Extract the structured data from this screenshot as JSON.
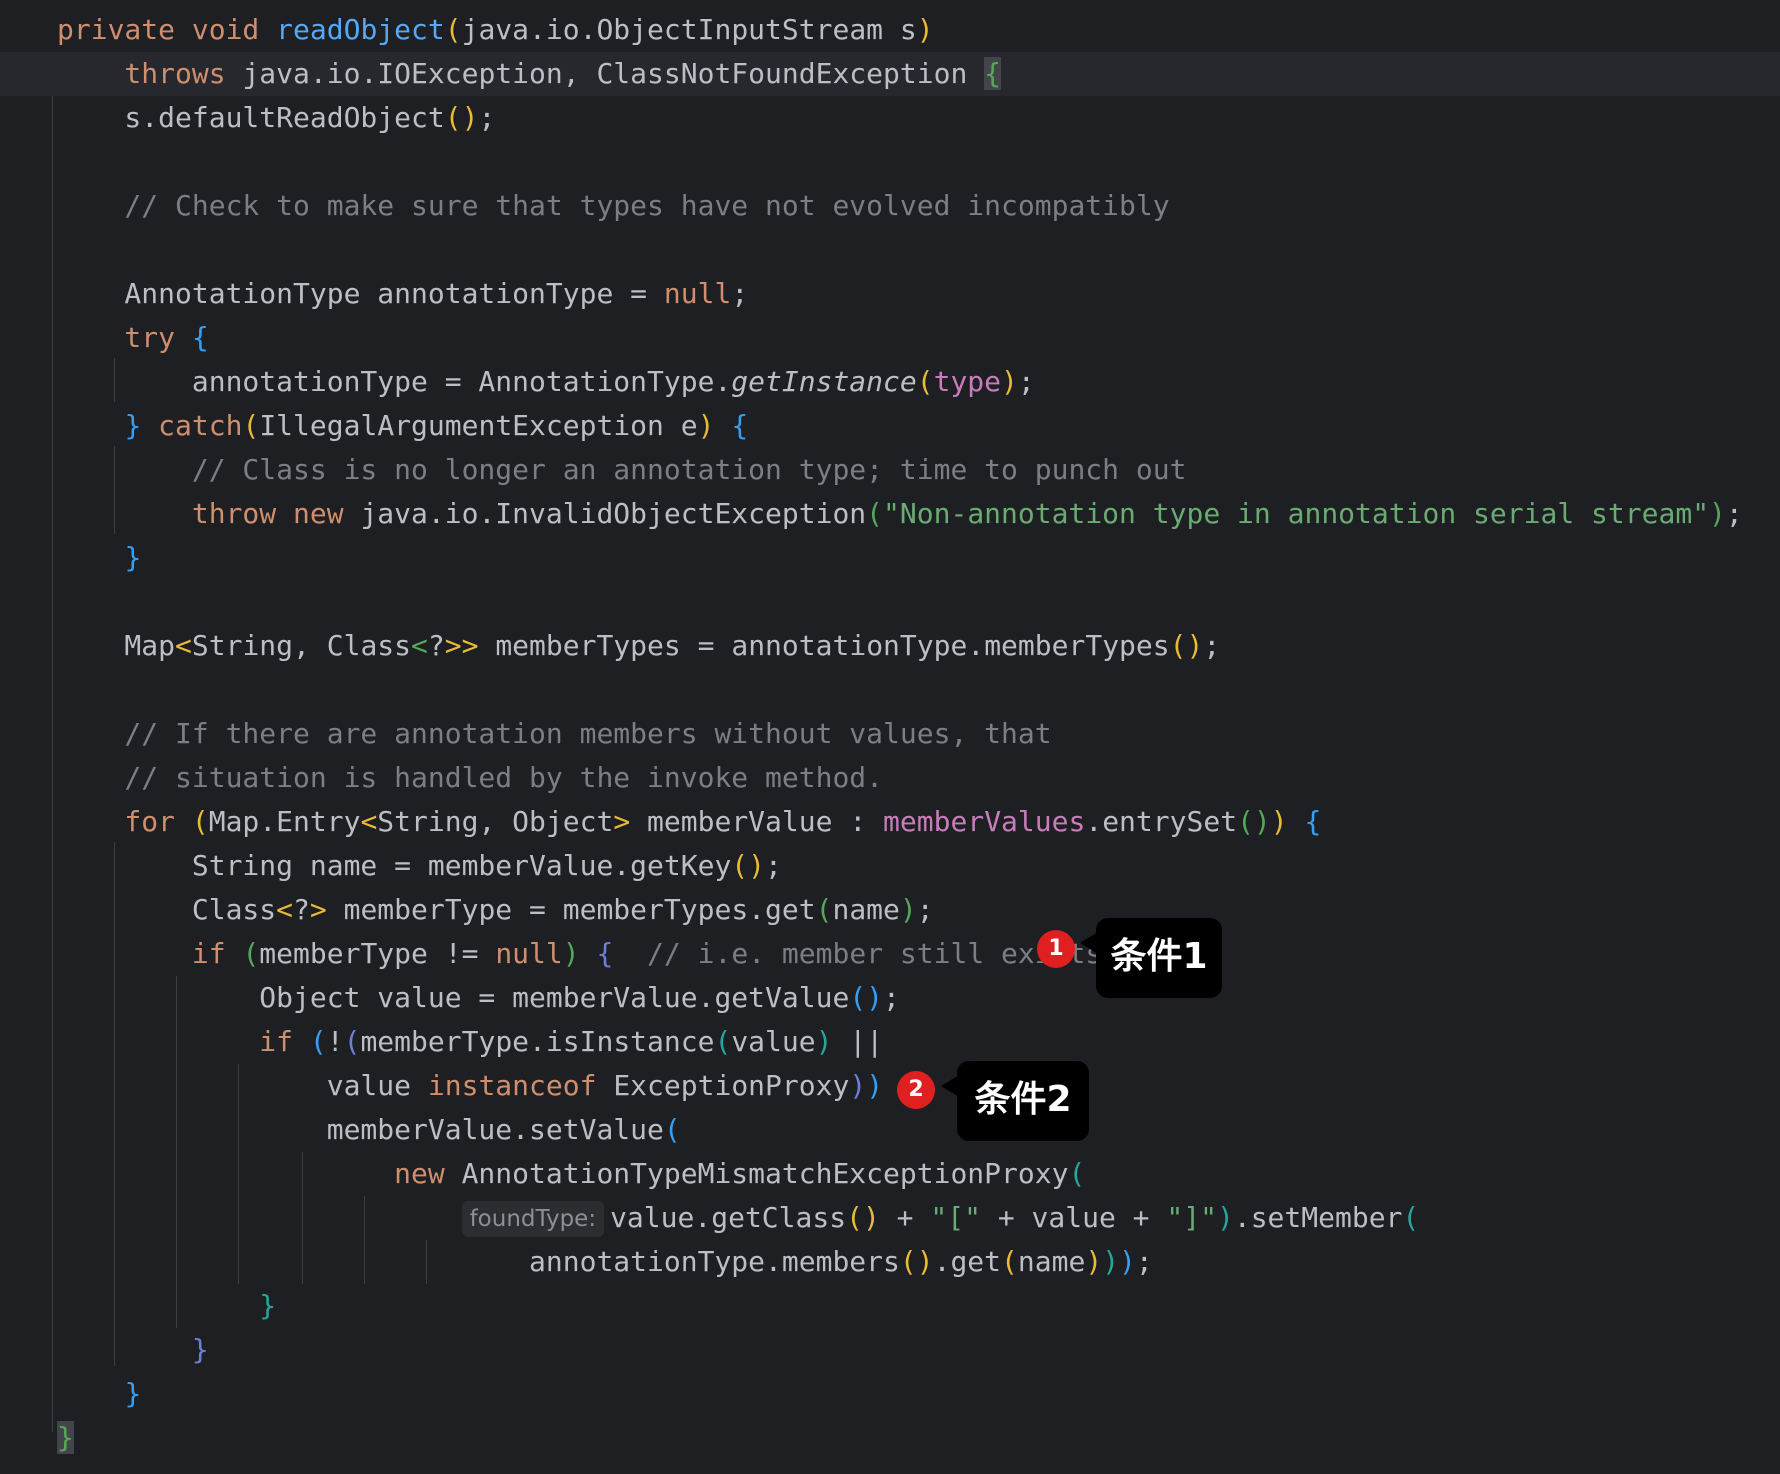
{
  "editor": {
    "language": "java",
    "lines": [
      [
        [
          "private void ",
          "kw"
        ],
        [
          "readObject",
          "fn"
        ],
        [
          "(",
          "by"
        ],
        [
          "java.io.ObjectInputStream s",
          ""
        ],
        [
          ")",
          "by"
        ]
      ],
      [
        [
          "    throws ",
          "kw"
        ],
        [
          "java.io.IOException, ClassNotFoundException ",
          ""
        ],
        [
          "{",
          "bg match"
        ]
      ],
      [
        [
          "    s.defaultReadObject",
          ""
        ],
        [
          "()",
          "by"
        ],
        [
          ";",
          ""
        ]
      ],
      [],
      [
        [
          "    // Check to make sure that types have not evolved incompatibly",
          "cm"
        ]
      ],
      [],
      [
        [
          "    AnnotationType annotationType = ",
          ""
        ],
        [
          "null",
          "kw"
        ],
        [
          ";",
          ""
        ]
      ],
      [
        [
          "    try ",
          "kw"
        ],
        [
          "{",
          "bb"
        ]
      ],
      [
        [
          "        annotationType = AnnotationType.",
          ""
        ],
        [
          "getInstance",
          "it"
        ],
        [
          "(",
          "by"
        ],
        [
          "type",
          "fl"
        ],
        [
          ")",
          "by"
        ],
        [
          ";",
          ""
        ]
      ],
      [
        [
          "    ",
          ""
        ],
        [
          "}",
          "bb"
        ],
        [
          " catch",
          "kw"
        ],
        [
          "(",
          "by"
        ],
        [
          "IllegalArgumentException e",
          ""
        ],
        [
          ")",
          "by"
        ],
        [
          " ",
          ""
        ],
        [
          "{",
          "bb"
        ]
      ],
      [
        [
          "        // Class is no longer an annotation type; time to punch out",
          "cm"
        ]
      ],
      [
        [
          "        throw new ",
          "kw"
        ],
        [
          "java.io.InvalidObjectException",
          ""
        ],
        [
          "(",
          "bg"
        ],
        [
          "\"Non-annotation type in annotation serial stream\"",
          "st"
        ],
        [
          ")",
          "bg"
        ],
        [
          ";",
          ""
        ]
      ],
      [
        [
          "    ",
          ""
        ],
        [
          "}",
          "bb"
        ]
      ],
      [],
      [
        [
          "    Map",
          ""
        ],
        [
          "<",
          "by"
        ],
        [
          "String, Class",
          ""
        ],
        [
          "<",
          "bg"
        ],
        [
          "?",
          ""
        ],
        [
          ">>",
          "by"
        ],
        [
          " memberTypes = annotationType.memberTypes",
          ""
        ],
        [
          "()",
          "by"
        ],
        [
          ";",
          ""
        ]
      ],
      [],
      [
        [
          "    // If there are annotation members without values, that",
          "cm"
        ]
      ],
      [
        [
          "    // situation is handled by the invoke method.",
          "cm"
        ]
      ],
      [
        [
          "    for ",
          "kw"
        ],
        [
          "(",
          "by"
        ],
        [
          "Map.Entry",
          ""
        ],
        [
          "<",
          "by"
        ],
        [
          "String, Object",
          ""
        ],
        [
          ">",
          "by"
        ],
        [
          " memberValue : ",
          ""
        ],
        [
          "memberValues",
          "fl"
        ],
        [
          ".entrySet",
          ""
        ],
        [
          "()",
          "bg"
        ],
        [
          ")",
          "by"
        ],
        [
          " ",
          ""
        ],
        [
          "{",
          "bb"
        ]
      ],
      [
        [
          "        String name = memberValue.getKey",
          ""
        ],
        [
          "()",
          "by"
        ],
        [
          ";",
          ""
        ]
      ],
      [
        [
          "        Class",
          ""
        ],
        [
          "<",
          "by"
        ],
        [
          "?",
          ""
        ],
        [
          ">",
          "by"
        ],
        [
          " memberType = memberTypes.get",
          ""
        ],
        [
          "(",
          "bg"
        ],
        [
          "name",
          ""
        ],
        [
          ")",
          "bg"
        ],
        [
          ";",
          ""
        ]
      ],
      [
        [
          "        if ",
          "kw"
        ],
        [
          "(",
          "bg"
        ],
        [
          "memberType != ",
          ""
        ],
        [
          "null",
          "kw"
        ],
        [
          ")",
          "bg"
        ],
        [
          " ",
          ""
        ],
        [
          "{",
          "bi"
        ],
        [
          "  // i.e. member still exists",
          "cm"
        ]
      ],
      [
        [
          "            Object value = memberValue.getValue",
          ""
        ],
        [
          "()",
          "bb"
        ],
        [
          ";",
          ""
        ]
      ],
      [
        [
          "            if ",
          "kw"
        ],
        [
          "(",
          "bb"
        ],
        [
          "!",
          ""
        ],
        [
          "(",
          "bi"
        ],
        [
          "memberType.isInstance",
          ""
        ],
        [
          "(",
          "bt"
        ],
        [
          "value",
          ""
        ],
        [
          ")",
          "bt"
        ],
        [
          " ||",
          ""
        ]
      ],
      [
        [
          "                value ",
          ""
        ],
        [
          "instanceof ",
          "kw"
        ],
        [
          "ExceptionProxy",
          ""
        ],
        [
          ")",
          "bi"
        ],
        [
          ")",
          "bb"
        ],
        [
          " ",
          ""
        ],
        [
          "{",
          "bt"
        ]
      ],
      [
        [
          "                memberValue.setValue",
          ""
        ],
        [
          "(",
          "bb"
        ]
      ],
      [
        [
          "                    new ",
          "kw"
        ],
        [
          "AnnotationTypeMismatchExceptionProxy",
          ""
        ],
        [
          "(",
          "bt"
        ]
      ],
      [
        [
          "                        ",
          ""
        ],
        [
          "foundType:",
          "hint"
        ],
        [
          "value.getClass",
          ""
        ],
        [
          "()",
          "by"
        ],
        [
          " + ",
          ""
        ],
        [
          "\"[\"",
          "st"
        ],
        [
          " + value + ",
          ""
        ],
        [
          "\"]\"",
          "st"
        ],
        [
          ")",
          "bt"
        ],
        [
          ".setMember",
          ""
        ],
        [
          "(",
          "bt"
        ]
      ],
      [
        [
          "                            annotationType.members",
          ""
        ],
        [
          "()",
          "by"
        ],
        [
          ".get",
          ""
        ],
        [
          "(",
          "by"
        ],
        [
          "name",
          ""
        ],
        [
          ")",
          "by"
        ],
        [
          ")",
          "bt"
        ],
        [
          ")",
          "bb"
        ],
        [
          ";",
          ""
        ]
      ],
      [
        [
          "            ",
          ""
        ],
        [
          "}",
          "bt"
        ]
      ],
      [
        [
          "        ",
          ""
        ],
        [
          "}",
          "bi"
        ]
      ],
      [
        [
          "    ",
          ""
        ],
        [
          "}",
          "bb"
        ]
      ],
      [
        [
          "}",
          "bg match"
        ]
      ]
    ]
  },
  "annotations": [
    {
      "number": "1",
      "label": "条件1"
    },
    {
      "number": "2",
      "label": "条件2"
    }
  ],
  "colors": {
    "background": "#1e1f22",
    "keyword": "#cf8e6d",
    "method": "#56a8f5",
    "comment": "#7a7e85",
    "string": "#6aab73",
    "field": "#c77dbb",
    "badge": "#e02020",
    "callout": "#000000"
  }
}
